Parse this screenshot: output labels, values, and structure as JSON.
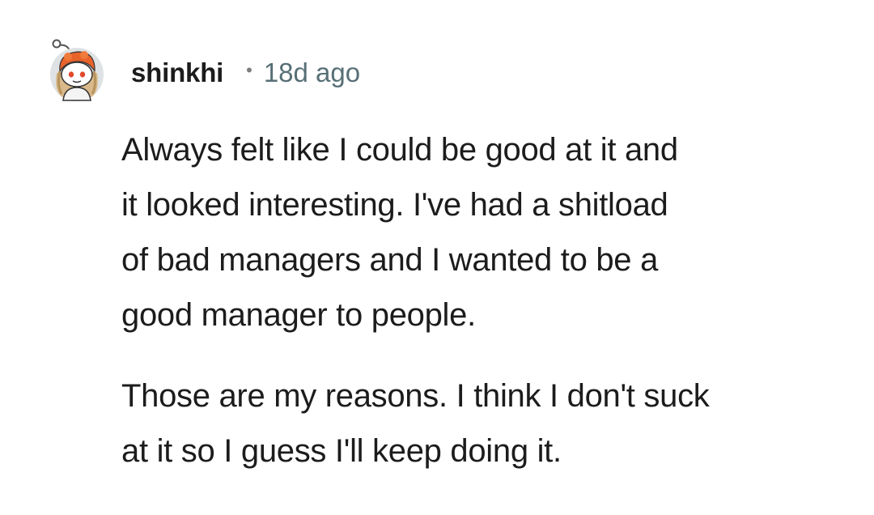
{
  "comment": {
    "author": "shinkhi",
    "separator": "•",
    "age": "18d ago",
    "avatar_icon": "snoo-avatar-icon",
    "paragraphs": [
      "Always felt like I could be good at it and\nit looked interesting. I've had a shitload\nof bad managers and I wanted to be a\ngood manager to people.",
      "Those are my reasons. I think I don't suck\nat it so I guess I'll keep doing it."
    ]
  },
  "colors": {
    "text": "#1c1c1c",
    "meta": "#576f76",
    "avatar_hair": "#e8622b"
  }
}
